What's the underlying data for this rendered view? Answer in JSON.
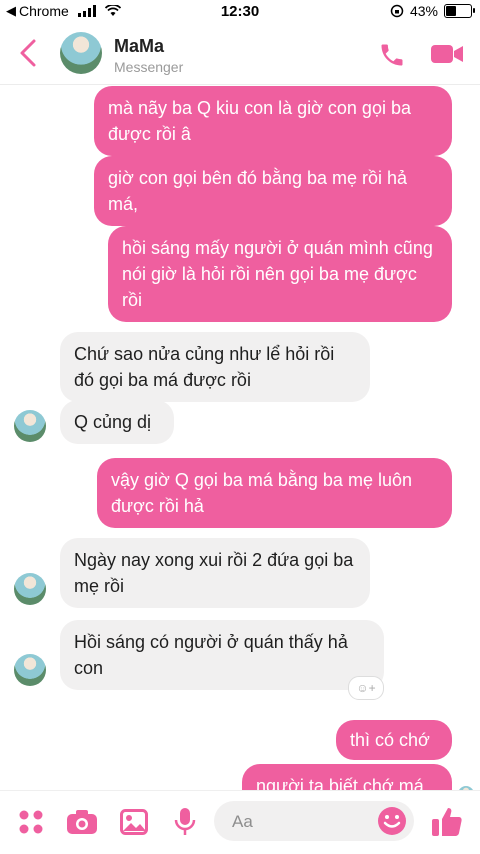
{
  "status_bar": {
    "back_app": "Chrome",
    "time": "12:30",
    "battery": "43%",
    "battery_level": 0.43
  },
  "header": {
    "contact_name": "MaMa",
    "subtitle": "Messenger"
  },
  "messages": [
    {
      "side": "out",
      "text": "mà nãy ba Q kiu con là giờ con gọi ba được rồi â"
    },
    {
      "side": "out",
      "text": "giờ con gọi bên đó bằng ba mẹ rồi hả má,"
    },
    {
      "side": "out",
      "text": "hồi sáng mấy người ở quán mình cũng nói giờ là hỏi rồi nên gọi ba mẹ được rồi"
    },
    {
      "side": "in",
      "text": "Chứ sao nửa củng như lể hỏi rồi đó gọi ba má được rồi"
    },
    {
      "side": "in",
      "text": "Q củng dị"
    },
    {
      "side": "out",
      "text": "vậy giờ Q gọi ba má bằng ba mẹ luôn được rồi hả"
    },
    {
      "side": "in",
      "text": "Ngày nay xong xui rồi  2 đứa gọi ba mẹ rồi"
    },
    {
      "side": "in",
      "text": "Hồi sáng có người ở quán thấy hả con"
    },
    {
      "side": "out",
      "text": "thì có chớ"
    },
    {
      "side": "out",
      "text": "người ta biết chớ má"
    }
  ],
  "composer": {
    "placeholder": "Aa"
  },
  "icons": {
    "back": "chevron-left-icon",
    "call": "phone-icon",
    "video": "video-camera-icon",
    "more": "four-dots-icon",
    "camera": "camera-icon",
    "gallery": "image-icon",
    "mic": "microphone-icon",
    "emoji": "smiley-icon",
    "like": "thumbs-up-icon"
  },
  "colors": {
    "accent": "#ef5f9f",
    "incoming_bubble": "#f1f0f0"
  }
}
